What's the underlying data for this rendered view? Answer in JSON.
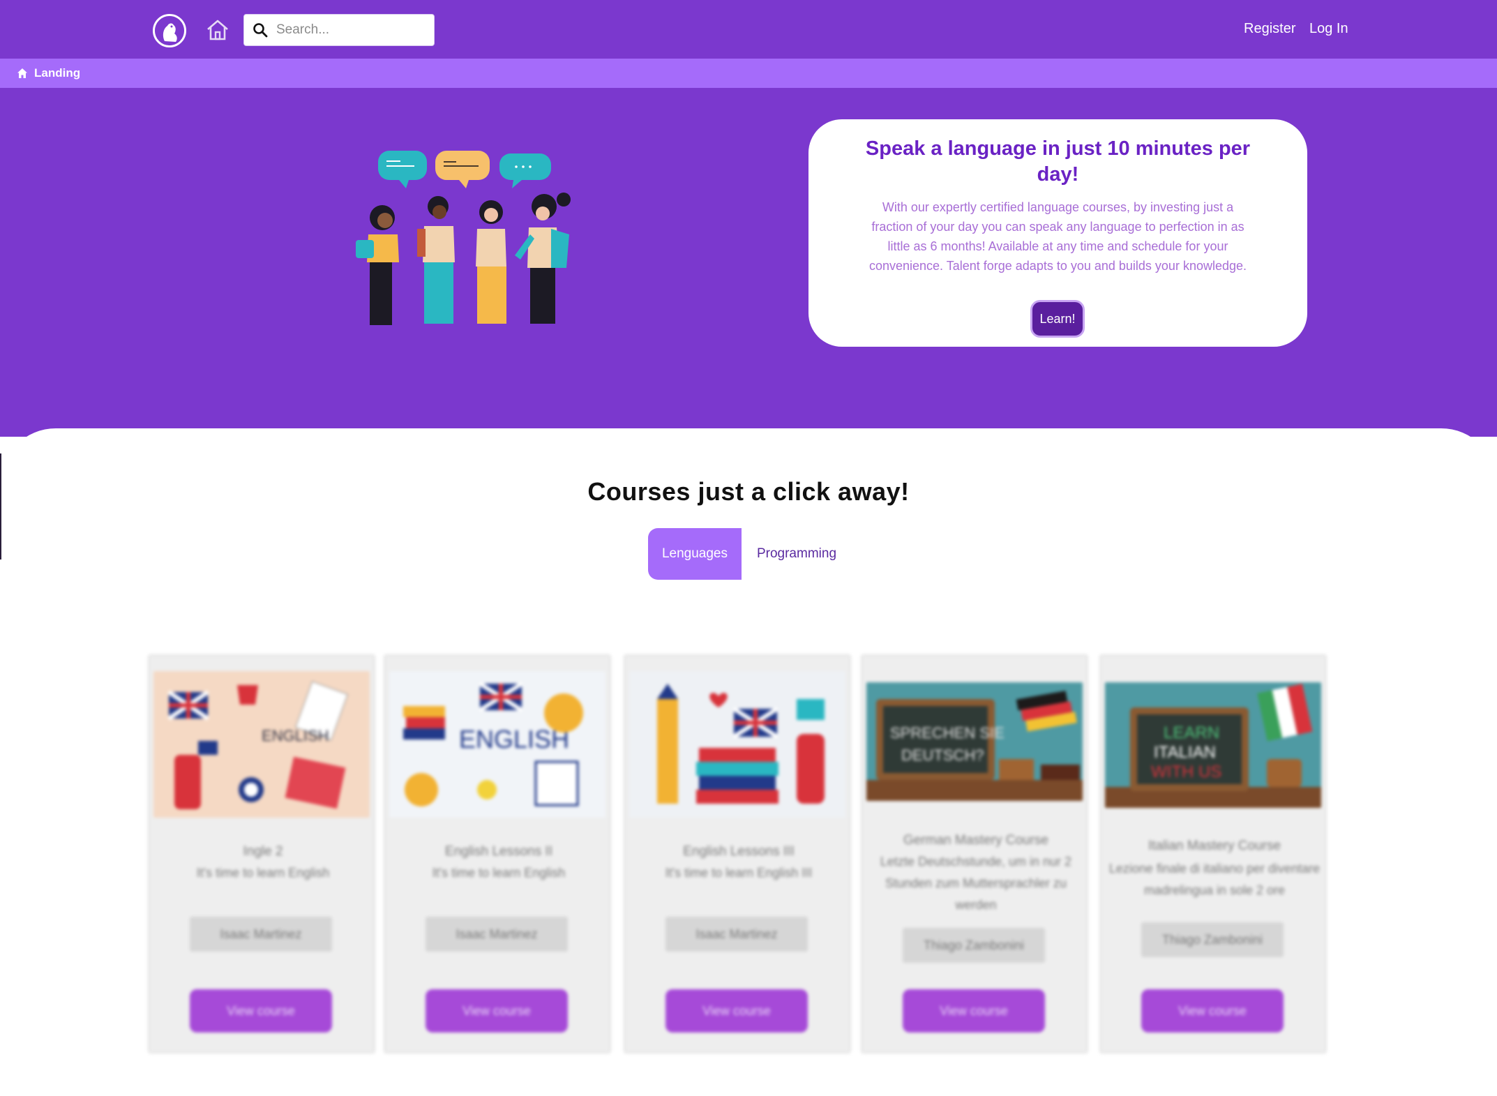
{
  "nav": {
    "logo_icon": "beaver-logo-icon",
    "home_icon": "home-icon",
    "search": {
      "placeholder": "Search...",
      "value": ""
    },
    "register_label": "Register",
    "login_label": "Log In"
  },
  "breadcrumb": {
    "icon": "home-icon",
    "label": "Landing"
  },
  "hero": {
    "illustration": "people-talking-illustration",
    "title": "Speak a language in just 10 minutes per day!",
    "description": "With our expertly certified language courses, by investing just a fraction of your day you can speak any language to perfection in as little as 6 months! Available at any time and schedule for your convenience. Talent forge adapts to you and builds your knowledge.",
    "cta_label": "Learn!"
  },
  "courses": {
    "title": "Courses just a click away!",
    "tabs": [
      {
        "label": "Lenguages",
        "active": true
      },
      {
        "label": "Programming",
        "active": false
      }
    ],
    "cards": [
      {
        "image": "english-lessons-image",
        "title": "Ingle 2",
        "subtitle": "It's time to learn English",
        "author": "Isaac Martinez",
        "button": "View course"
      },
      {
        "image": "english-courses-image",
        "title": "English Lessons II",
        "subtitle": "It's time to learn English",
        "author": "Isaac Martinez",
        "button": "View course"
      },
      {
        "image": "english-books-london-image",
        "title": "English Lessons III",
        "subtitle": "It's time to learn English III",
        "author": "Isaac Martinez",
        "button": "View course"
      },
      {
        "image": "german-chalkboard-image",
        "title": "German Mastery Course",
        "subtitle": "Letzte Deutschstunde, um in nur 2 Stunden zum Muttersprachler zu werden",
        "author": "Thiago Zambonini",
        "button": "View course"
      },
      {
        "image": "italian-chalkboard-image",
        "title": "Italian Mastery Course",
        "subtitle": "Lezione finale di italiano per diventare madrelingua in sole 2 ore",
        "author": "Thiago Zambonini",
        "button": "View course"
      }
    ]
  },
  "colors": {
    "primary": "#7b38ce",
    "breadcrumb_bar": "#a56bfa",
    "hero_title": "#6a22c4",
    "cta": "#5a1f9e",
    "card_button": "#a64ad8"
  }
}
